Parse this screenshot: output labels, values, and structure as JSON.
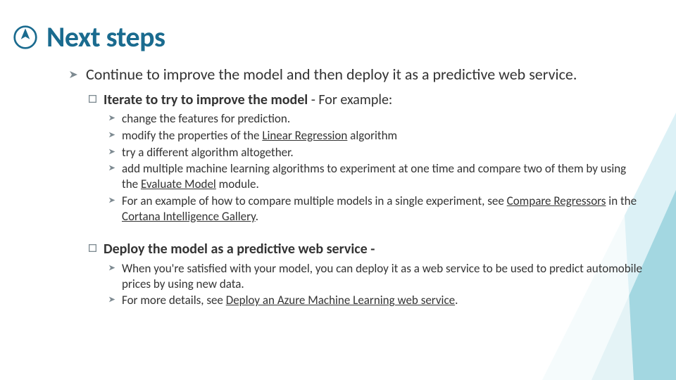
{
  "colors": {
    "accent": "#1a6b8f",
    "bullet_gray": "#7d8a91",
    "deco_teal": "#3aa6b9",
    "deco_teal_light": "#bfe6ee"
  },
  "title": "Next steps",
  "level1": [
    {
      "text": "Continue to improve the model and then deploy it as a predictive web service."
    }
  ],
  "sections": [
    {
      "heading_bold": "Iterate to try to improve the model",
      "heading_tail": " - For example:",
      "items": [
        {
          "pre": "change the features for prediction.",
          "link": "",
          "post": ""
        },
        {
          "pre": "modify the properties of the ",
          "link": "Linear Regression",
          "post": " algorithm"
        },
        {
          "pre": "try a different algorithm altogether.",
          "link": "",
          "post": ""
        },
        {
          "pre": "add multiple machine learning algorithms to experiment at one time and compare two of them by using the ",
          "link": "Evaluate Model",
          "post": " module."
        },
        {
          "pre": "For an example of how to compare multiple models in a single experiment, see ",
          "link": "Compare Regressors",
          "post": " in the ",
          "link2": "Cortana Intelligence Gallery",
          "post2": "."
        }
      ]
    },
    {
      "heading_bold": "Deploy the model as a predictive web service -",
      "heading_tail": "",
      "items": [
        {
          "pre": "When you're satisfied with your model, you can deploy it as a web service to be used to predict automobile prices by using new data.",
          "link": "",
          "post": ""
        },
        {
          "pre": "For more details, see ",
          "link": "Deploy an Azure Machine Learning web service",
          "post": "."
        }
      ]
    }
  ]
}
